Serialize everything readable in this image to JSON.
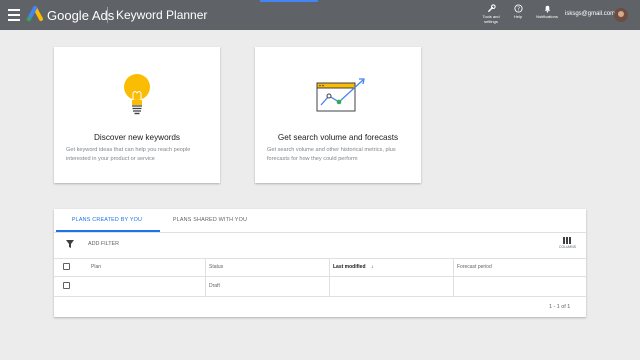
{
  "header": {
    "brand": "Google Ads",
    "page_title": "Keyword Planner",
    "tools": [
      {
        "label": "Tools and settings",
        "icon": "wrench-icon"
      },
      {
        "label": "Help",
        "icon": "help-icon"
      },
      {
        "label": "Notifications",
        "icon": "bell-icon"
      }
    ],
    "account": "isksgs@gmail.com"
  },
  "cards": [
    {
      "title": "Discover new keywords",
      "description": "Get keyword ideas that can help you reach people interested in your product or service",
      "icon": "lightbulb-icon"
    },
    {
      "title": "Get search volume and forecasts",
      "description": "Get search volume and other historical metrics, plus forecasts for how they could perform",
      "icon": "chart-trend-icon"
    }
  ],
  "plans": {
    "tabs": [
      {
        "label": "PLANS CREATED BY YOU",
        "active": true
      },
      {
        "label": "PLANS SHARED WITH YOU",
        "active": false
      }
    ],
    "add_filter_label": "ADD FILTER",
    "columns_label": "COLUMNS",
    "columns": [
      "Plan",
      "Status",
      "Last modified",
      "Forecast period"
    ],
    "sorted_column_arrow": "↓",
    "rows": [
      {
        "plan": "",
        "status": "Draft",
        "last_modified": "",
        "forecast_period": ""
      }
    ],
    "pagination": "1 - 1 of 1"
  },
  "colors": {
    "topbar": "#5f6368",
    "accent": "#1a73e8",
    "bulb": "#fbbc04",
    "background": "#ececec"
  }
}
